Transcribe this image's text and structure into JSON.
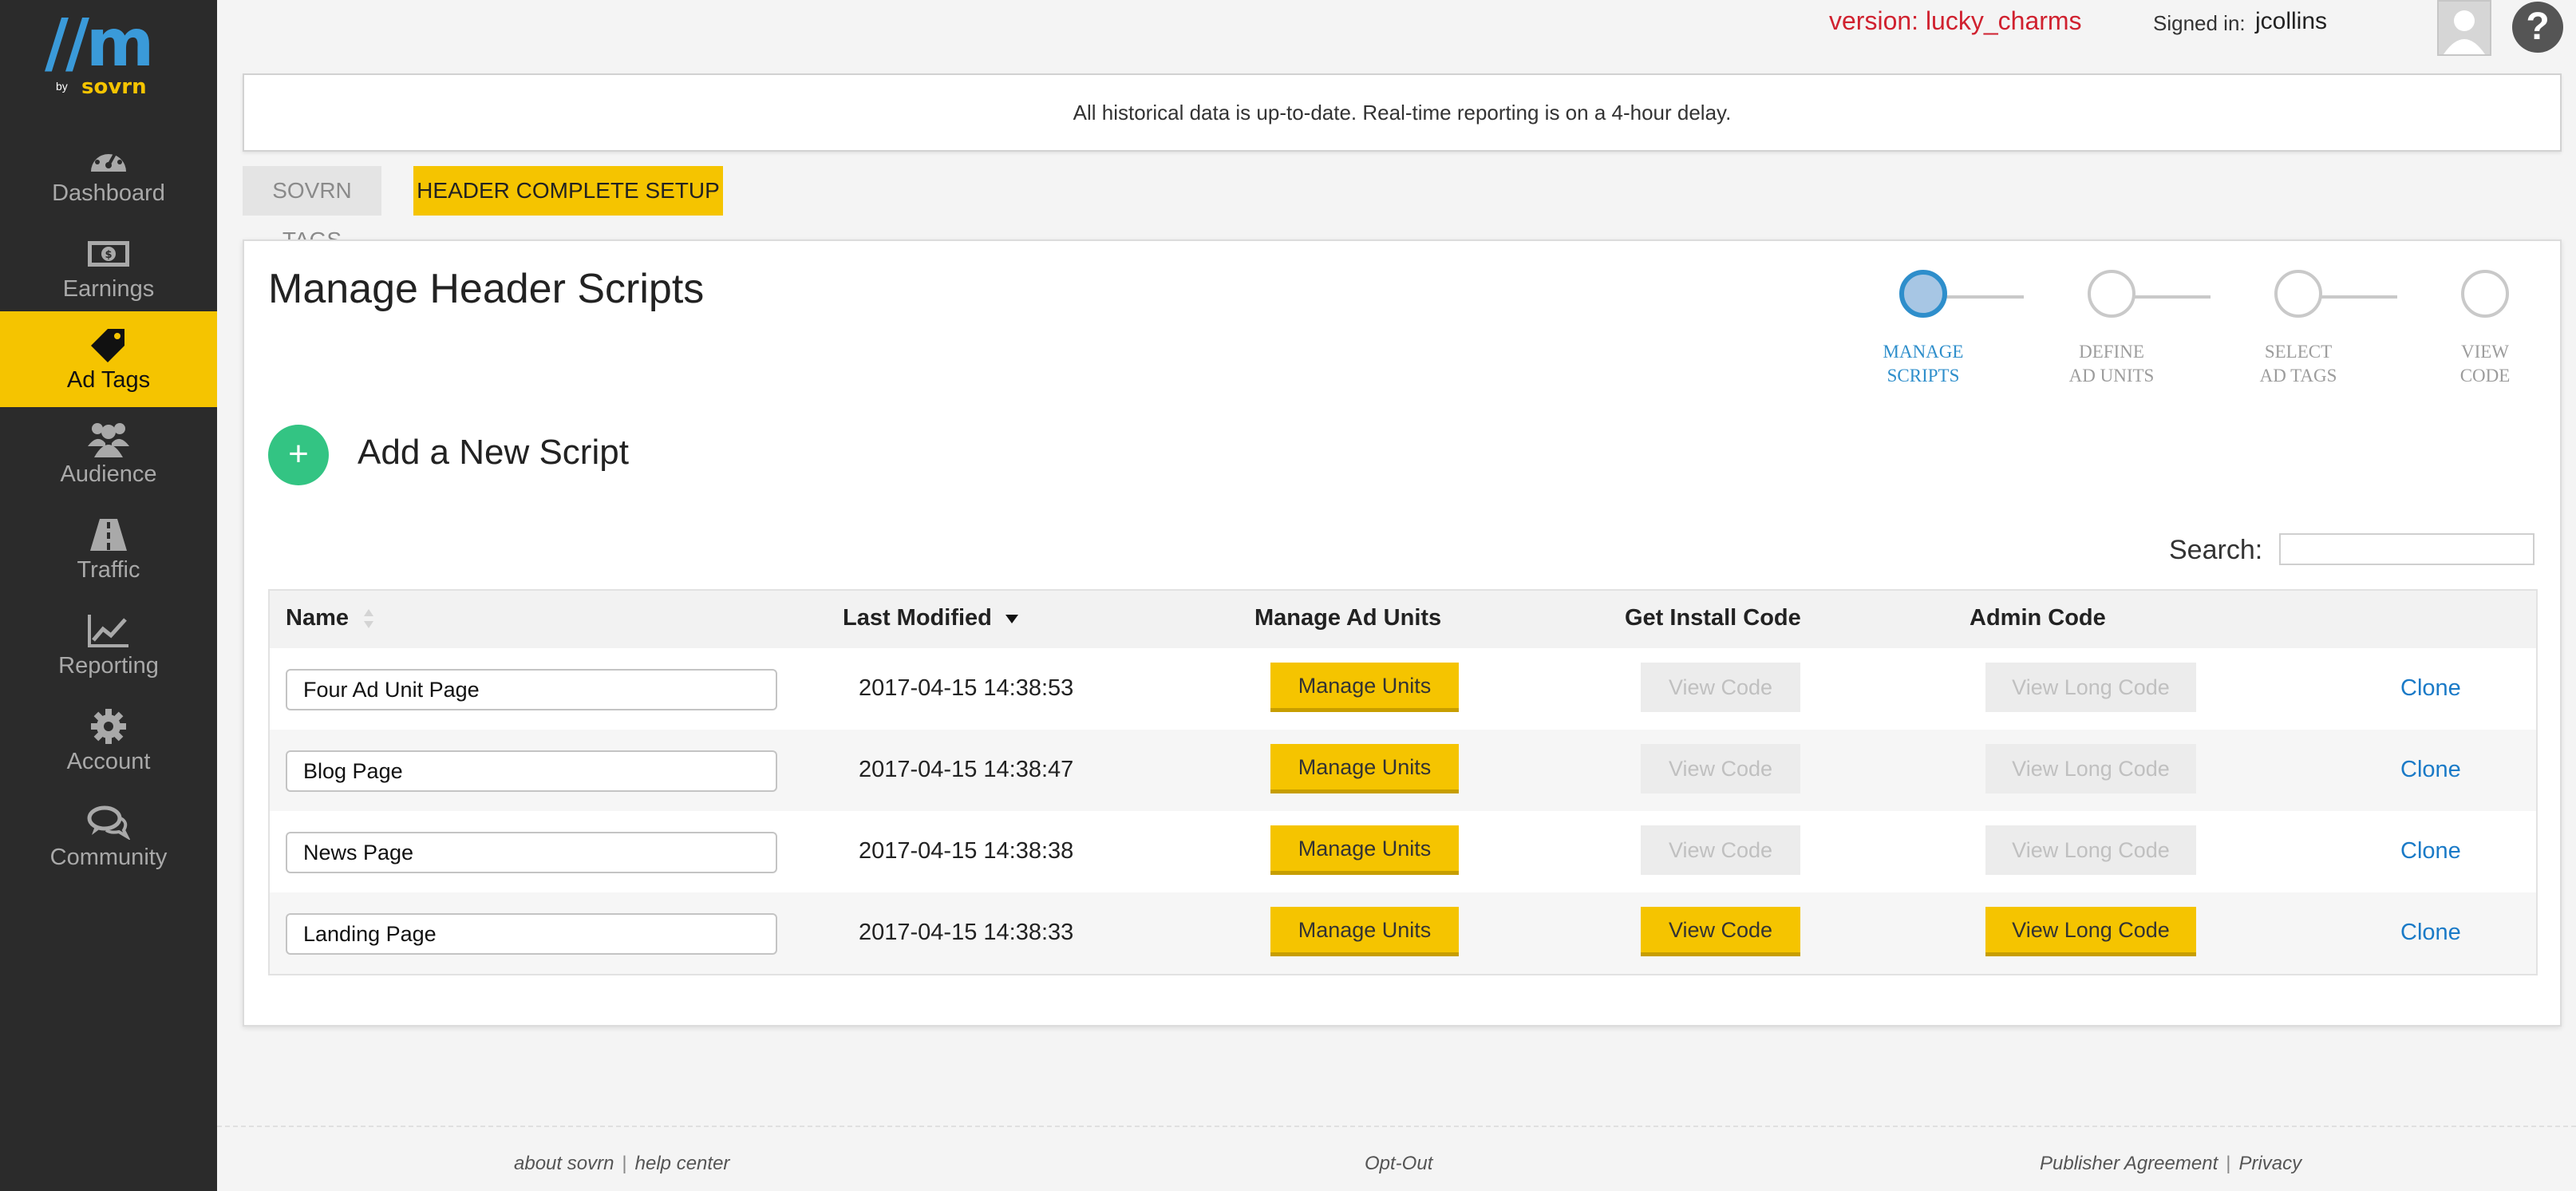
{
  "brand": {
    "mark": "//m",
    "by": "by",
    "name": "sovrn"
  },
  "sidebar": {
    "items": [
      {
        "label": "Dashboard",
        "icon": "gauge-icon",
        "active": false
      },
      {
        "label": "Earnings",
        "icon": "money-icon",
        "active": false
      },
      {
        "label": "Ad Tags",
        "icon": "tag-icon",
        "active": true
      },
      {
        "label": "Audience",
        "icon": "people-icon",
        "active": false
      },
      {
        "label": "Traffic",
        "icon": "road-icon",
        "active": false
      },
      {
        "label": "Reporting",
        "icon": "line-chart-icon",
        "active": false
      },
      {
        "label": "Account",
        "icon": "gear-icon",
        "active": false
      },
      {
        "label": "Community",
        "icon": "chat-bubbles-icon",
        "active": false
      }
    ]
  },
  "header": {
    "version": "version: lucky_charms",
    "signed_in_label": "Signed in:",
    "username": "jcollins",
    "help": "?"
  },
  "notice": "All historical data is up-to-date. Real-time reporting is on a 4-hour delay.",
  "tabs": [
    {
      "label": "SOVRN TAGS",
      "active": false
    },
    {
      "label": "HEADER COMPLETE SETUP",
      "active": true
    }
  ],
  "main": {
    "title": "Manage Header Scripts",
    "steps": [
      {
        "line1": "MANAGE",
        "line2": "SCRIPTS",
        "active": true
      },
      {
        "line1": "DEFINE",
        "line2": "AD UNITS",
        "active": false
      },
      {
        "line1": "SELECT",
        "line2": "AD TAGS",
        "active": false
      },
      {
        "line1": "VIEW",
        "line2": "CODE",
        "active": false
      }
    ],
    "add_icon": "+",
    "add_label": "Add a New Script",
    "search_label": "Search:",
    "search_value": ""
  },
  "table": {
    "columns": [
      "Name",
      "Last Modified",
      "Manage Ad Units",
      "Get Install Code",
      "Admin Code"
    ],
    "sort_column": "Last Modified",
    "sort_direction": "descending",
    "rows": [
      {
        "name": "Four Ad Unit Page",
        "modified": "2017-04-15 14:38:53",
        "manage": "Manage Units",
        "view": "View Code",
        "long": "View Long Code",
        "clone": "Clone",
        "code_enabled": false
      },
      {
        "name": "Blog Page",
        "modified": "2017-04-15 14:38:47",
        "manage": "Manage Units",
        "view": "View Code",
        "long": "View Long Code",
        "clone": "Clone",
        "code_enabled": false
      },
      {
        "name": "News Page",
        "modified": "2017-04-15 14:38:38",
        "manage": "Manage Units",
        "view": "View Code",
        "long": "View Long Code",
        "clone": "Clone",
        "code_enabled": false
      },
      {
        "name": "Landing Page",
        "modified": "2017-04-15 14:38:33",
        "manage": "Manage Units",
        "view": "View Code",
        "long": "View Long Code",
        "clone": "Clone",
        "code_enabled": true
      }
    ]
  },
  "footer": {
    "about": "about sovrn",
    "help_center": "help center",
    "opt_out": "Opt-Out",
    "agreement": "Publisher Agreement",
    "privacy": "Privacy",
    "separator": "|"
  },
  "colors": {
    "sidebar": "#2b2b2b",
    "accent_yellow": "#f5c400",
    "step_blue": "#2e8ecb",
    "add_green": "#33c483",
    "version_red": "#d0212f",
    "link_blue": "#1a7ac7"
  }
}
